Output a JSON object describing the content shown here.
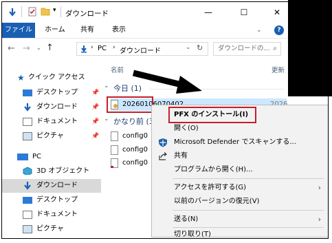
{
  "window": {
    "title": "ダウンロード",
    "controls": {
      "minimize": "—",
      "maximize": "☐",
      "close": "✕"
    }
  },
  "ribbon": {
    "tabs": [
      "ファイル",
      "ホーム",
      "共有",
      "表示"
    ],
    "help": "?"
  },
  "address": {
    "path": [
      "PC",
      "ダウンロード"
    ],
    "search_placeholder": "ダウンロードの..."
  },
  "sidebar": {
    "quick_access": "クイック アクセス",
    "quick_items": [
      "デスクトップ",
      "ダウンロード",
      "ドキュメント",
      "ピクチャ"
    ],
    "pc": "PC",
    "pc_items": [
      "3D オブジェクト",
      "ダウンロード",
      "デスクトップ",
      "ドキュメント",
      "ピクチャ"
    ],
    "pin_symbol": "📌"
  },
  "main": {
    "columns": {
      "name": "名前",
      "modified": "更新"
    },
    "groups": [
      {
        "label": "今日 (1)",
        "files": [
          "20260106070402"
        ]
      },
      {
        "label": "かなり前 (3)",
        "files": [
          "config0",
          "config0",
          "config0"
        ]
      }
    ],
    "date_fragment": "2026"
  },
  "context_menu": {
    "items": [
      {
        "label": "PFX のインストール(I)",
        "bold": true,
        "highlighted": true
      },
      {
        "label": "開く(O)"
      },
      {
        "label": "Microsoft Defender でスキャンする...",
        "icon": "defender-shield-icon"
      },
      {
        "label": "共有",
        "icon": "share-icon"
      },
      {
        "label": "プログラムから開く(H)..."
      },
      {
        "label": "アクセスを許可する(G)",
        "submenu": true
      },
      {
        "label": "以前のバージョンの復元(V)"
      },
      {
        "label": "送る(N)",
        "submenu": true
      },
      {
        "label": "切り取り(T)"
      }
    ],
    "submenu_arrow": "›"
  },
  "colors": {
    "accent": "#1a5fb4",
    "highlight": "#c41e2a",
    "selection": "#d9d9d9",
    "menu_bg": "#f2f2f2"
  }
}
